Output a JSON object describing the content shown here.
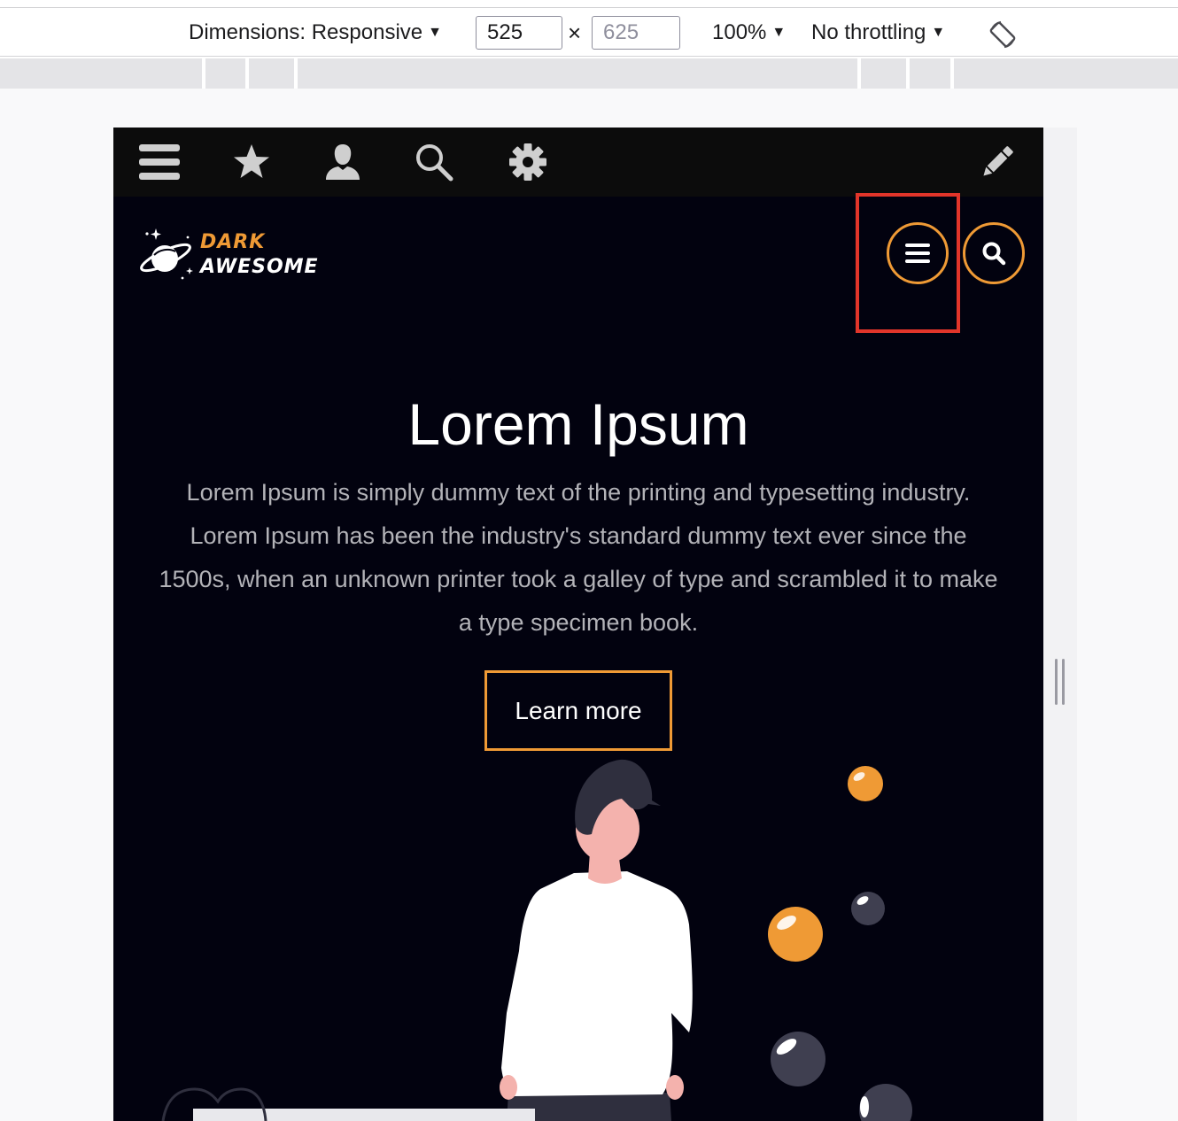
{
  "devtools": {
    "dimensions_label": "Dimensions: Responsive",
    "width_value": "525",
    "height_placeholder": "625",
    "times": "×",
    "zoom_label": "100%",
    "throttling_label": "No throttling",
    "caret": "▼"
  },
  "site": {
    "logo": {
      "line1": "DARK",
      "line2": "AWESOME"
    },
    "colors": {
      "accent": "#ef9a35",
      "background": "#02020f",
      "highlight": "#e2352a"
    },
    "hero": {
      "title": "Lorem Ipsum",
      "text": "Lorem Ipsum is simply dummy text of the printing and typesetting industry. Lorem Ipsum has been the industry's standard dummy text ever since the 1500s, when an unknown printer took a galley of type and scrambled it to make a type specimen book.",
      "button_label": "Learn more"
    }
  }
}
